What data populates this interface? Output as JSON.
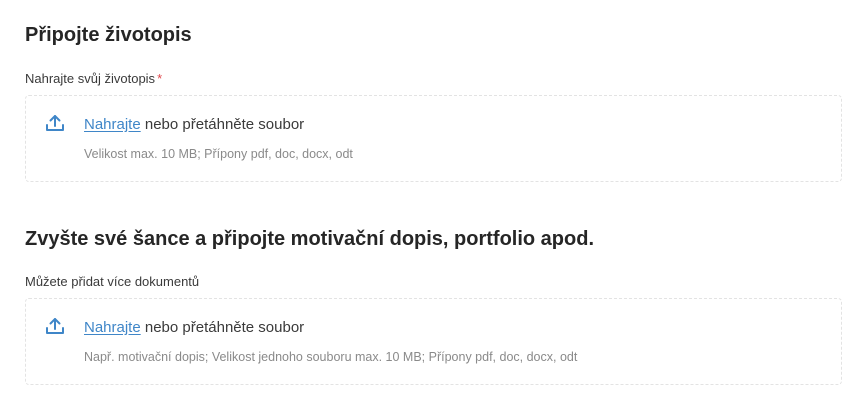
{
  "resume": {
    "title": "Připojte životopis",
    "label": "Nahrajte svůj životopis",
    "required_mark": "*",
    "upload": {
      "link": "Nahrajte",
      "text": " nebo přetáhněte soubor",
      "hint": "Velikost max. 10 MB; Přípony pdf, doc, docx, odt",
      "icon": "upload-icon"
    }
  },
  "documents": {
    "title": "Zvyšte své šance a připojte motivační dopis, portfolio apod.",
    "label": "Můžete přidat více dokumentů",
    "upload": {
      "link": "Nahrajte",
      "text": " nebo přetáhněte soubor",
      "hint": "Např. motivační dopis; Velikost jednoho souboru max. 10 MB; Přípony pdf, doc, docx, odt",
      "icon": "upload-icon"
    }
  },
  "colors": {
    "link": "#3f86c8",
    "required": "#e0474c",
    "dropzone_border": "#e3e3e3"
  }
}
